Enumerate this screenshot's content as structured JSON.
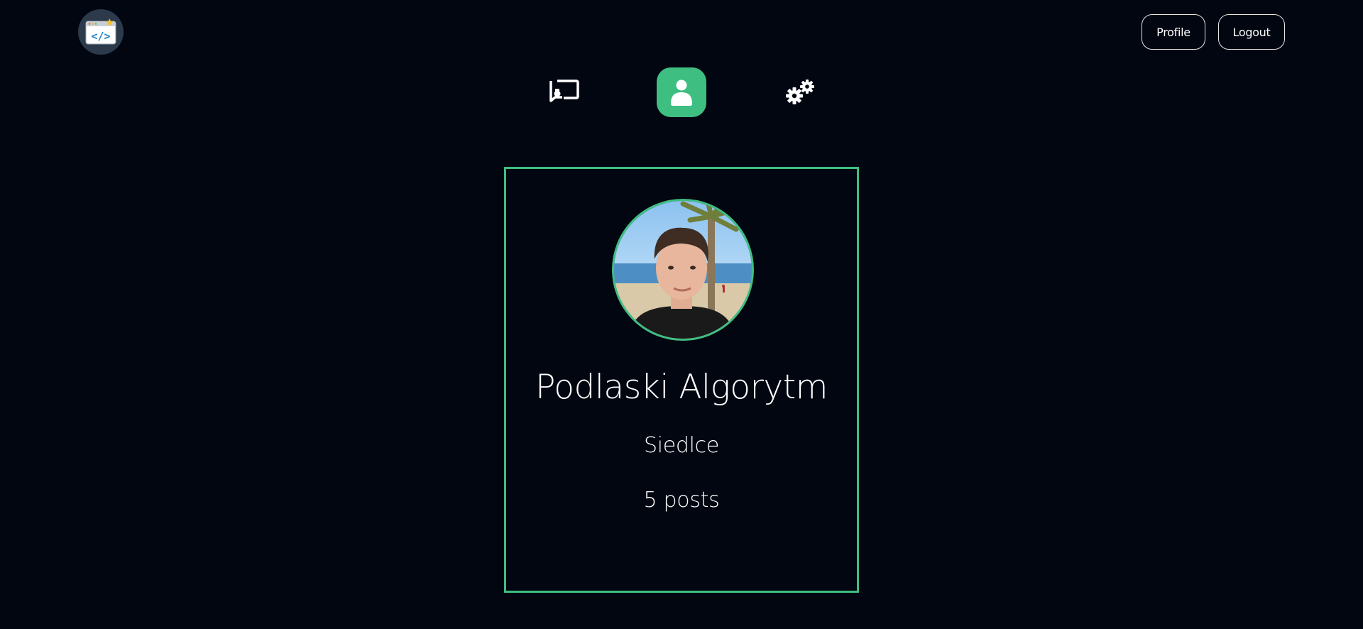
{
  "header": {
    "logo_icon": "code-window-icon",
    "nav": {
      "profile_label": "Profile",
      "logout_label": "Logout"
    }
  },
  "tabs": [
    {
      "icon": "posts-icon",
      "active": false
    },
    {
      "icon": "user-icon",
      "active": true
    },
    {
      "icon": "gears-icon",
      "active": false
    }
  ],
  "profile": {
    "name": "Podlaski Algorytm",
    "location": "Siedlce",
    "posts_count": "5 posts"
  },
  "colors": {
    "background": "#020611",
    "accent": "#3fbe82",
    "logo_bg": "#2c3a4c"
  }
}
